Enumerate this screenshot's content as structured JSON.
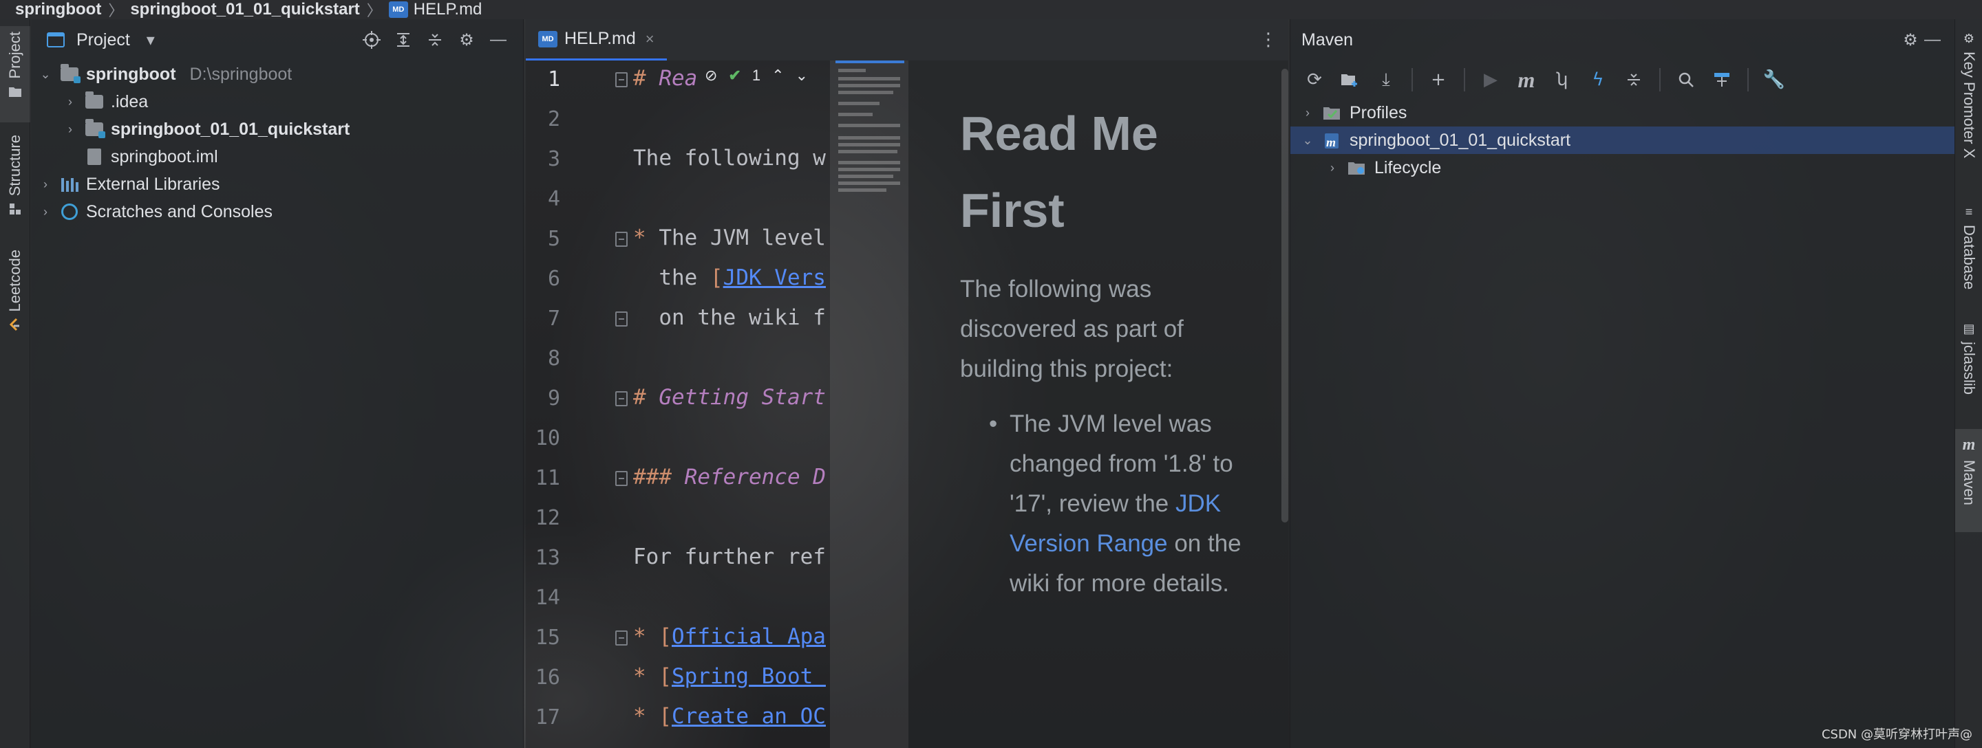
{
  "breadcrumb": {
    "items": [
      "springboot",
      "springboot_01_01_quickstart"
    ],
    "file": "HELP.md",
    "file_badge": "MD"
  },
  "left_strip": {
    "tabs": [
      "Project",
      "Structure",
      "Leetcode"
    ]
  },
  "project_panel": {
    "title": "Project",
    "tree": [
      {
        "label": "springboot",
        "path": "D:\\springboot"
      },
      {
        "label": ".idea"
      },
      {
        "label": "springboot_01_01_quickstart"
      },
      {
        "label": "springboot.iml"
      },
      {
        "label": "External Libraries"
      },
      {
        "label": "Scratches and Consoles"
      }
    ]
  },
  "editor": {
    "tab_label": "HELP.md",
    "tab_badge": "MD",
    "inspection_count": "1",
    "line_numbers": [
      "1",
      "2",
      "3",
      "4",
      "5",
      "6",
      "7",
      "8",
      "9",
      "10",
      "11",
      "12",
      "13",
      "14",
      "15",
      "16",
      "17"
    ],
    "lines": {
      "l1_mark": "#",
      "l1_text": " Rea",
      "l3_text": "The following w",
      "l5_mark": "*",
      "l5_text": " The JVM level",
      "l6_pre": "  the ",
      "l6_brk": "[",
      "l6_link": "JDK Vers",
      "l7_text": "  on the wiki f",
      "l9_mark": "#",
      "l9_text": " Getting Start",
      "l11_mark": "###",
      "l11_text": " Reference D",
      "l13_text": "For further ref",
      "l15_mark": "*",
      "l15_brk": " [",
      "l15_link": "Official Apa",
      "l16_mark": "*",
      "l16_brk": " [",
      "l16_link": "Spring Boot ",
      "l17_mark": "*",
      "l17_brk": " [",
      "l17_link": "Create an OC"
    }
  },
  "preview": {
    "heading": "Read Me First",
    "intro": "The following was discovered as part of building this project:",
    "bullet_text": "The JVM level was changed from '1.8' to '17', review the ",
    "bullet_link": "JDK Version Range",
    "bullet_tail": " on the wiki for more details."
  },
  "maven_panel": {
    "title": "Maven",
    "toolbar_icons": [
      "reload-icon",
      "add-folder-icon",
      "download-icon",
      "plus-icon",
      "run-icon",
      "maven-m-icon",
      "toggle-offline-icon",
      "skip-tests-icon",
      "collapse-icon",
      "analyze-icon",
      "show-deps-icon",
      "settings-wrench-icon"
    ],
    "tree": [
      {
        "label": "Profiles"
      },
      {
        "label": "springboot_01_01_quickstart"
      },
      {
        "label": "Lifecycle"
      }
    ]
  },
  "right_strip": {
    "tabs": [
      "Key Promoter X",
      "Database",
      "jclasslib",
      "Maven"
    ]
  },
  "watermark": "CSDN @莫听穿林打叶声@",
  "colors": {
    "accent": "#3574f0",
    "link": "#548af7",
    "markdown_mark": "#cf8e6d",
    "heading_italic": "#b57fbf",
    "selection": "#2e436e"
  }
}
